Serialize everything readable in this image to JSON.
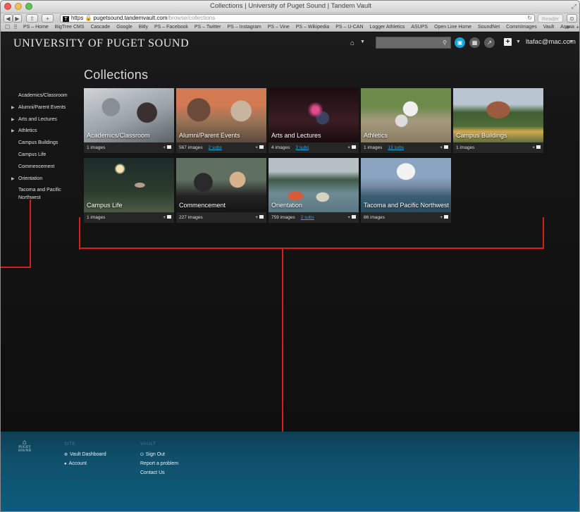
{
  "window": {
    "title": "Collections | University of Puget Sound | Tandem Vault"
  },
  "toolbar": {
    "back": "◀",
    "forward": "▶",
    "share": "⇧",
    "add": "+",
    "url_scheme": "https",
    "url_host": "pugetsound.tandemvault.com",
    "url_path": "/browse/collections",
    "reader": "Reader"
  },
  "bookmarks": [
    "PS – Home",
    "BigTree CMS",
    "Cascade",
    "Google",
    "Bitly",
    "PS – Facebook",
    "PS – Twitter",
    "PS – Instagram",
    "PS – Vine",
    "PS – Wikipedia",
    "PS – U-CAN",
    "Logger Athletics",
    "ASUPS",
    "Open Line Home",
    "SoundNet",
    "CommImages",
    "Vault",
    "Asana"
  ],
  "header": {
    "brand": "UNIVERSITY OF PUGET SOUND",
    "user": "ltafac@mac.com",
    "search_placeholder": ""
  },
  "page": {
    "title": "Collections"
  },
  "sidebar": {
    "items": [
      {
        "label": "Academics/Classroom",
        "has_children": false
      },
      {
        "label": "Alumni/Parent Events",
        "has_children": true
      },
      {
        "label": "Arts and Lectures",
        "has_children": true
      },
      {
        "label": "Athletics",
        "has_children": true
      },
      {
        "label": "Campus Buildings",
        "has_children": false
      },
      {
        "label": "Campus Life",
        "has_children": false
      },
      {
        "label": "Commencement",
        "has_children": false
      },
      {
        "label": "Orientation",
        "has_children": true
      },
      {
        "label": "Tacoma and Pacific Northwest",
        "has_children": false
      }
    ]
  },
  "collections": [
    {
      "name": "Academics/Classroom",
      "count": "1 images",
      "subs": ""
    },
    {
      "name": "Alumni/Parent Events",
      "count": "567 images",
      "subs": "2 subs"
    },
    {
      "name": "Arts and Lectures",
      "count": "4 images",
      "subs": "3 subs"
    },
    {
      "name": "Athletics",
      "count": "1 images",
      "subs": "13 subs"
    },
    {
      "name": "Campus Buildings",
      "count": "1 images",
      "subs": ""
    },
    {
      "name": "Campus Life",
      "count": "1 images",
      "subs": ""
    },
    {
      "name": "Commencement",
      "count": "227 images",
      "subs": ""
    },
    {
      "name": "Orientation",
      "count": "759 images",
      "subs": "2 subs"
    },
    {
      "name": "Tacoma and Pacific Northwest",
      "count": "86 images",
      "subs": ""
    }
  ],
  "footer": {
    "logo_text": "PUGET SOUND",
    "col1_heading": "SITE",
    "col1_links": [
      "Vault Dashboard",
      "Account"
    ],
    "col2_heading": "VAULT",
    "col2_links": [
      "Sign Out",
      "Report a problem",
      "Contact Us"
    ]
  },
  "colors": {
    "accent": "#1aa2d6",
    "annotation": "#d91e1e",
    "footer": "#0e5b7d"
  }
}
